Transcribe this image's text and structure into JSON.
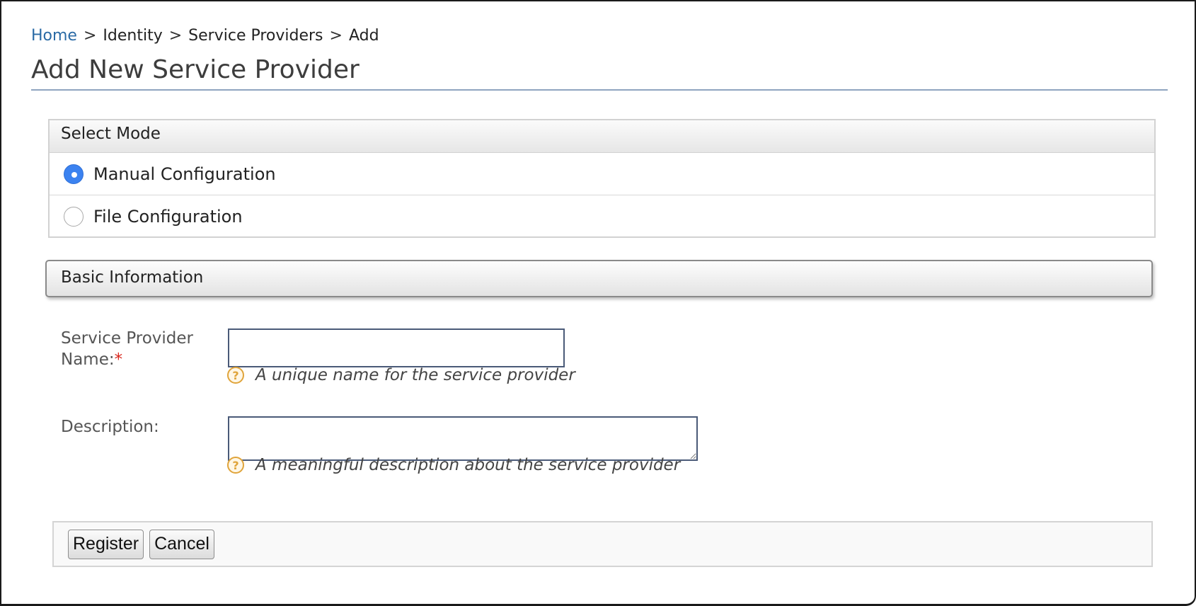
{
  "breadcrumb": {
    "home": "Home",
    "separator": ">",
    "identity": "Identity",
    "service_providers": "Service Providers",
    "current": "Add"
  },
  "page": {
    "title": "Add New Service Provider"
  },
  "select_mode": {
    "header": "Select Mode",
    "options": [
      {
        "label": "Manual Configuration",
        "selected": true
      },
      {
        "label": "File Configuration",
        "selected": false
      }
    ]
  },
  "basic_info": {
    "header": "Basic Information",
    "name_label": "Service Provider Name:",
    "name_required_mark": "*",
    "name_value": "",
    "name_help": "A unique name for the service provider",
    "description_label": "Description:",
    "description_value": "",
    "description_help": "A meaningful description about the service provider"
  },
  "actions": {
    "register_label": "Register",
    "cancel_label": "Cancel"
  },
  "icons": {
    "help": "help-icon",
    "help_glyph": "?"
  },
  "colors": {
    "link": "#2a6aa5",
    "radio_selected": "#3b82f0",
    "required": "#d9261c",
    "help_icon": "#e0a43a"
  }
}
